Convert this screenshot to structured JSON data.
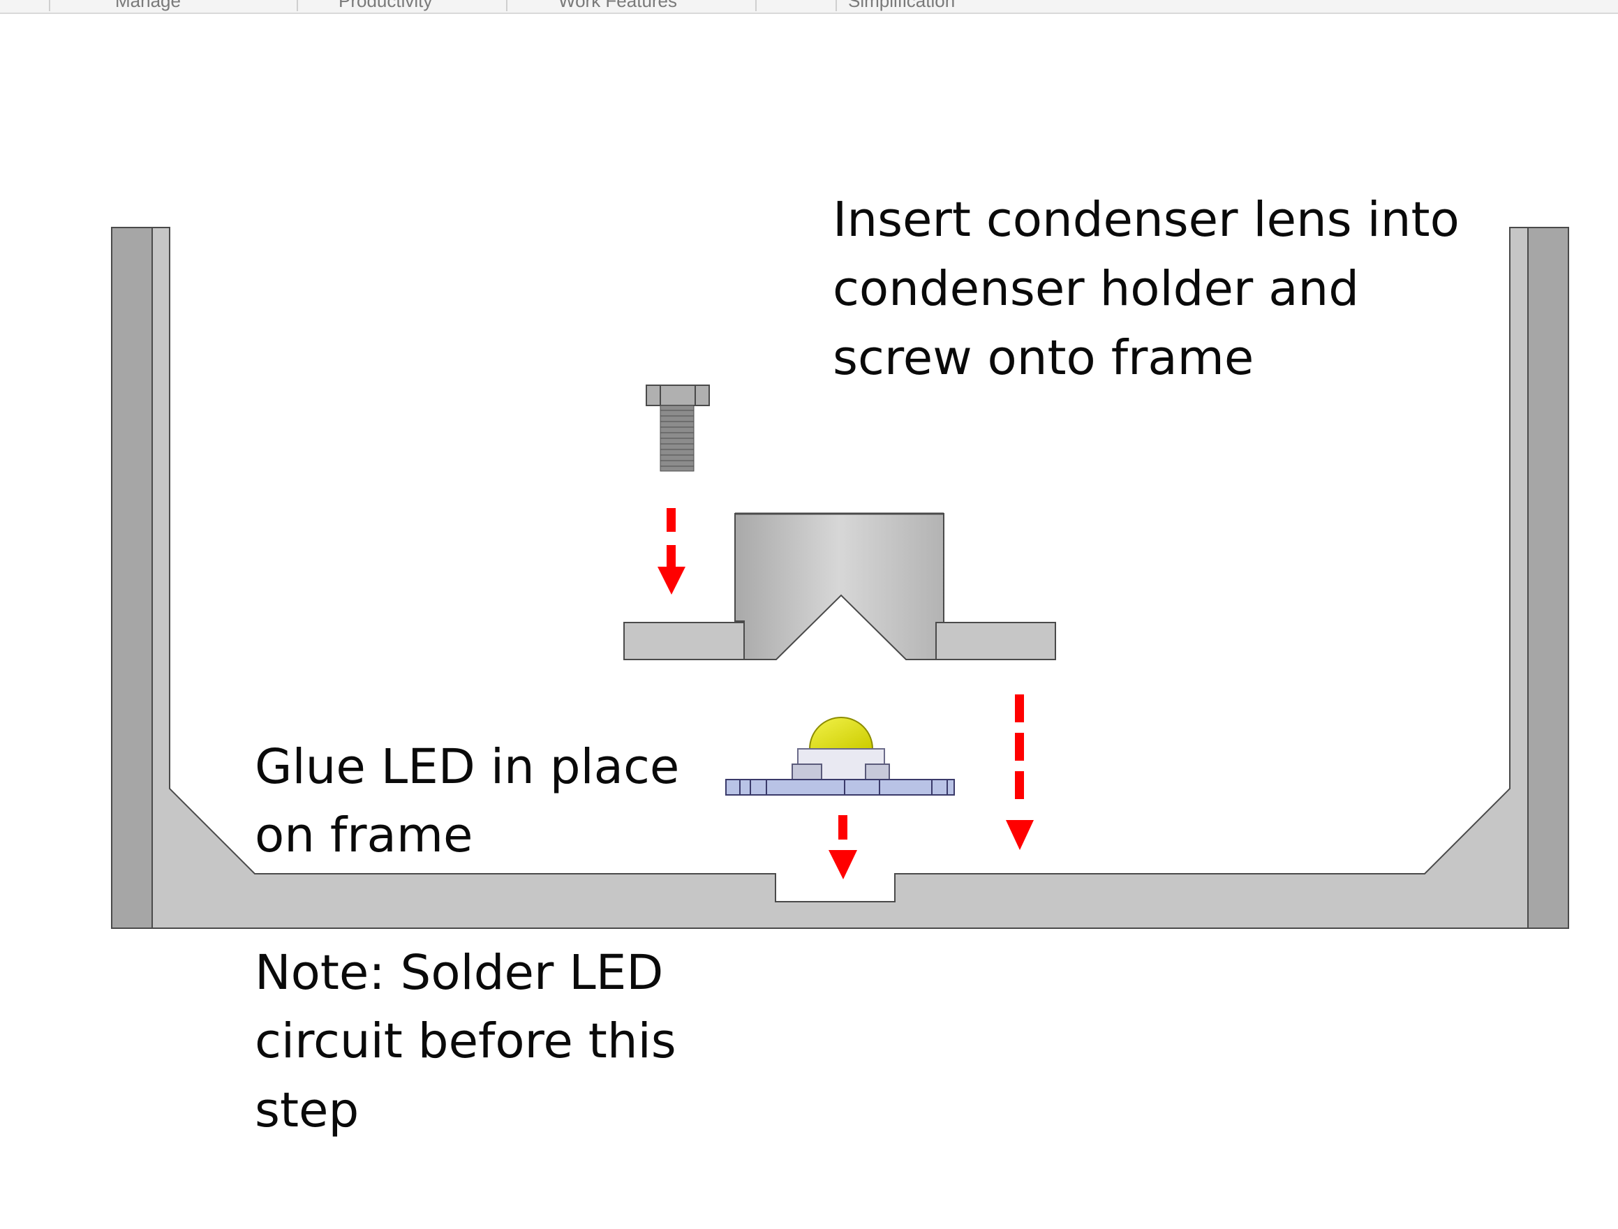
{
  "ribbon": {
    "tabs": [
      "Manage",
      "Productivity",
      "Work Features",
      "Simplification"
    ]
  },
  "colors": {
    "frame_fill": "#c6c6c6",
    "frame_edge": "#a6a6a6",
    "outline": "#4a4a4a",
    "arrow_red": "#ff0000",
    "led_yellow": "#e6e600",
    "led_board": "#b9c3e6",
    "bolt_gray": "#8a8a8a"
  },
  "icons": [
    "hex-bolt-icon",
    "condenser-holder-icon",
    "led-icon",
    "frame-icon",
    "arrow-down-icon"
  ],
  "labels": {
    "condenser": [
      "Insert condenser lens into",
      "condenser holder and",
      "screw onto frame"
    ],
    "glue": [
      "Glue LED in place",
      "on frame"
    ],
    "note": [
      "Note: Solder LED",
      "circuit before this",
      "step"
    ]
  }
}
